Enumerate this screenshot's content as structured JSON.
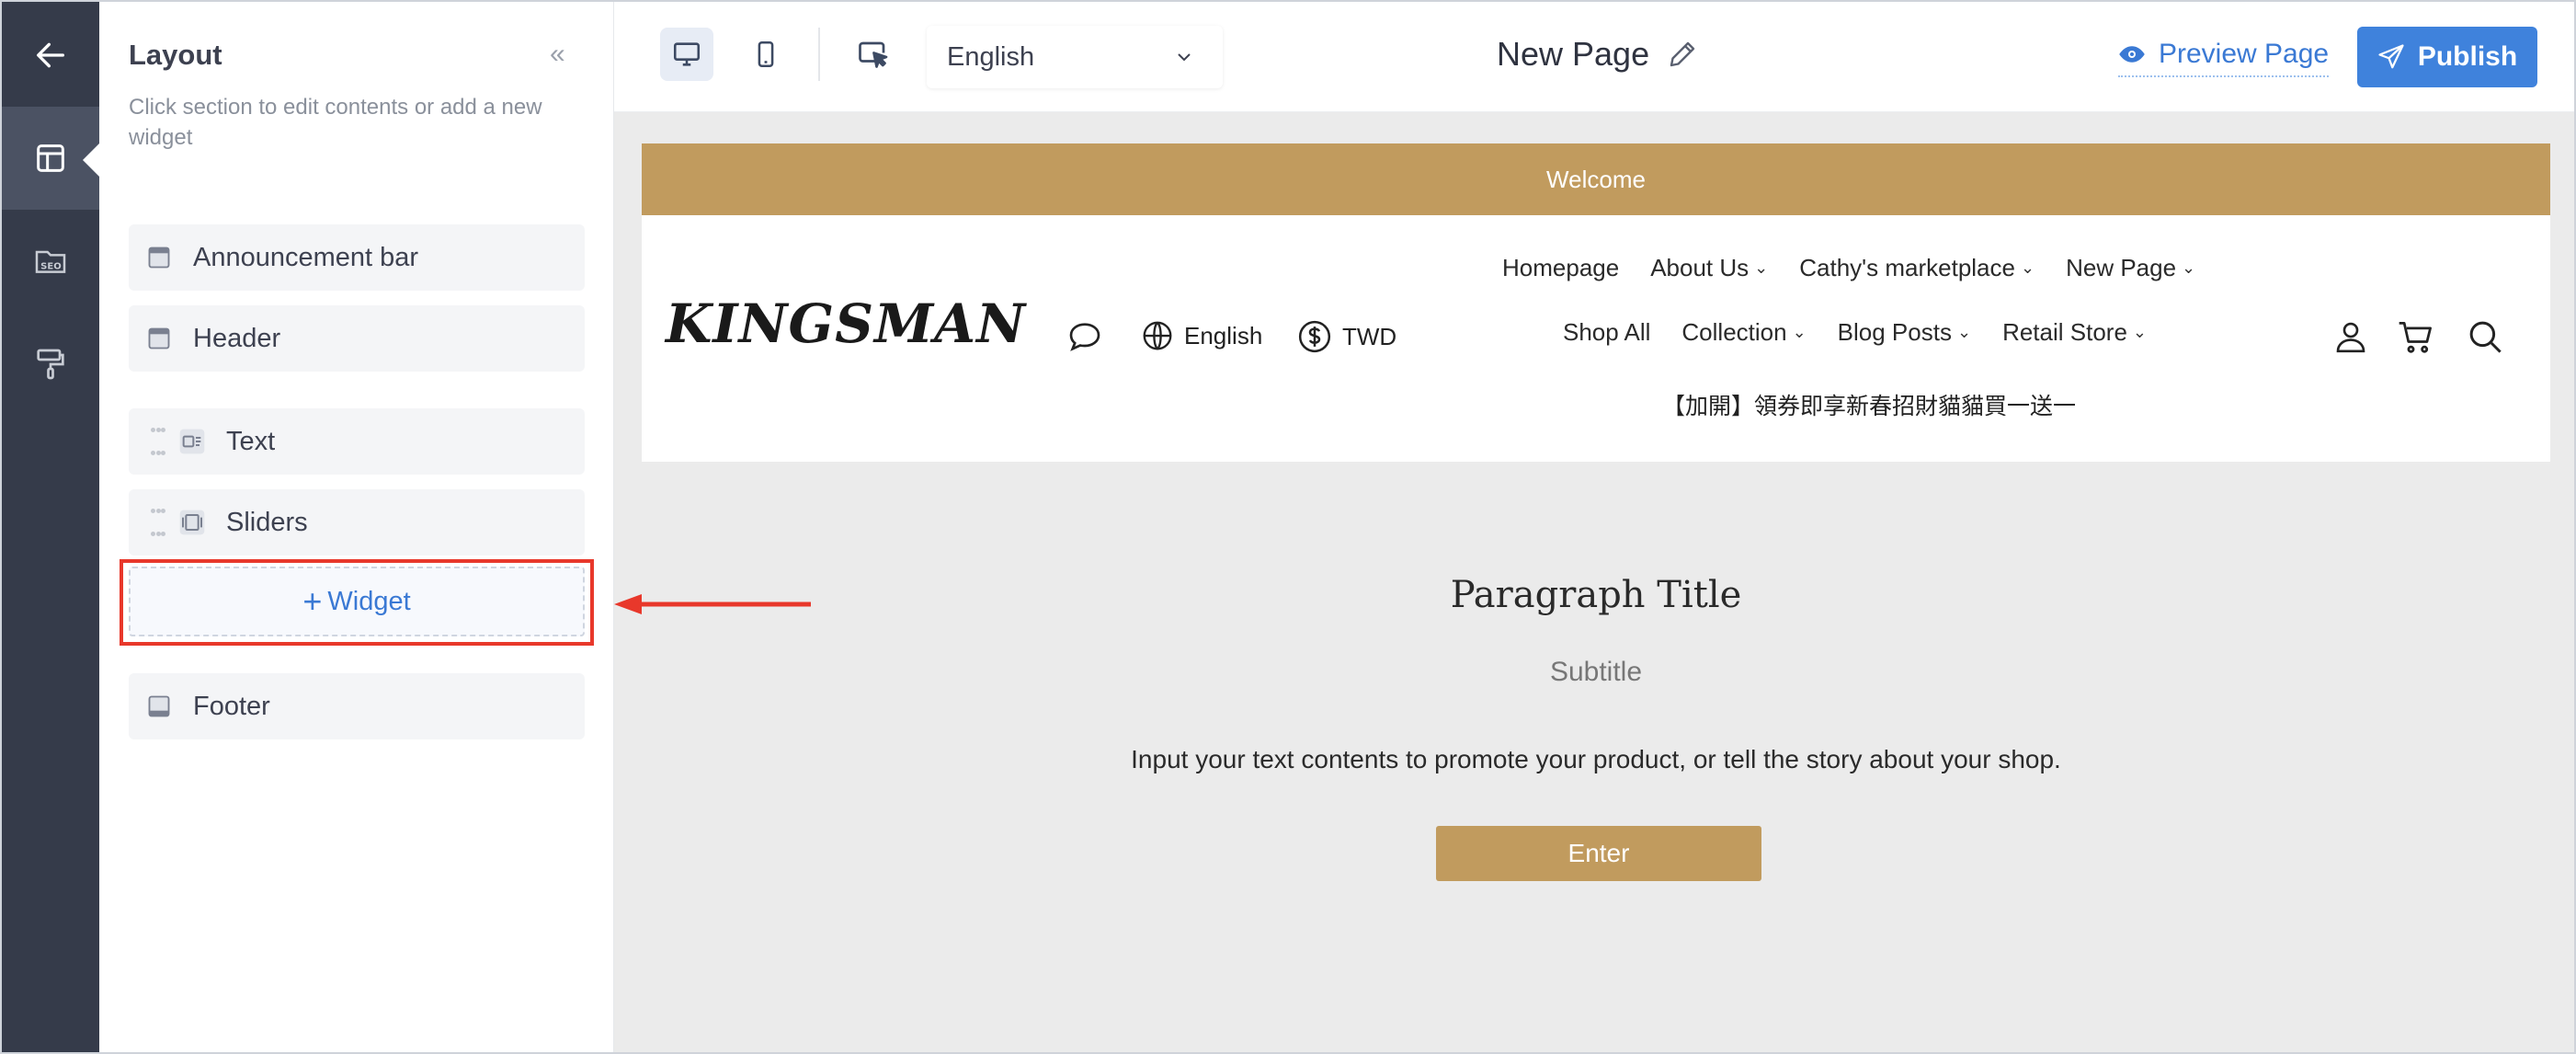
{
  "rail": {
    "items": [
      {
        "name": "back",
        "icon": "arrow-left-icon"
      },
      {
        "name": "layout",
        "icon": "layout-icon",
        "active": true
      },
      {
        "name": "seo",
        "icon": "seo-icon"
      },
      {
        "name": "theme",
        "icon": "paint-roller-icon"
      }
    ]
  },
  "panel": {
    "title": "Layout",
    "collapse": "«",
    "description": "Click section to edit contents or add a new widget",
    "sections": [
      {
        "label": "Announcement bar",
        "icon": "window-icon"
      },
      {
        "label": "Header",
        "icon": "window-icon"
      },
      {
        "label": "Text",
        "icon": "text-widget-icon"
      },
      {
        "label": "Sliders",
        "icon": "slider-widget-icon"
      },
      {
        "label": "Footer",
        "icon": "footer-icon"
      }
    ],
    "add_widget": {
      "plus": "+",
      "label": "Widget"
    }
  },
  "toolbar": {
    "language": "English",
    "page_title": "New Page",
    "preview_label": "Preview Page",
    "publish_label": "Publish"
  },
  "site": {
    "announcement": "Welcome",
    "logo": "KINGSMAN",
    "language": "English",
    "currency": "TWD",
    "nav_row1": [
      {
        "label": "Homepage",
        "caret": ""
      },
      {
        "label": "About Us",
        "caret": "⌄"
      },
      {
        "label": "Cathy's marketplace",
        "caret": "⌄"
      },
      {
        "label": "New Page",
        "caret": "⌄"
      }
    ],
    "nav_row2": [
      {
        "label": "Shop All",
        "caret": ""
      },
      {
        "label": "Collection",
        "caret": "⌄"
      },
      {
        "label": "Blog Posts",
        "caret": "⌄"
      },
      {
        "label": "Retail Store",
        "caret": "⌄"
      }
    ],
    "promo": "【加開】領券即享新春招財貓貓買一送一"
  },
  "content": {
    "title": "Paragraph Title",
    "subtitle": "Subtitle",
    "body": "Input your text contents to promote your product, or tell the story about your shop.",
    "button": "Enter"
  },
  "colors": {
    "rail": "#353b4a",
    "accent": "#3f82dc",
    "brand_gold": "#c19b5e",
    "highlight_red": "#e8382b"
  }
}
